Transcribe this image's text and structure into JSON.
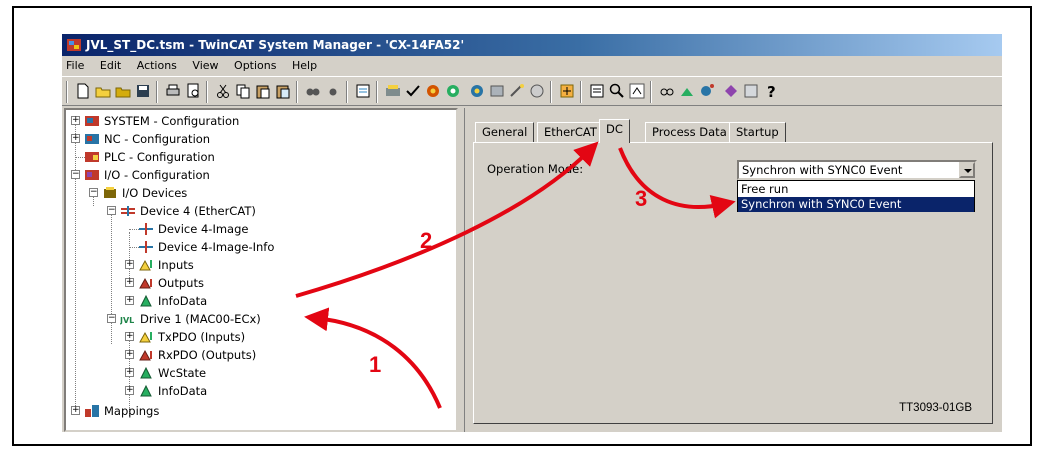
{
  "window": {
    "title": "JVL_ST_DC.tsm - TwinCAT System Manager - 'CX-14FA52'"
  },
  "menu": [
    "File",
    "Edit",
    "Actions",
    "View",
    "Options",
    "Help"
  ],
  "tree": {
    "nodes": [
      {
        "label": "SYSTEM - Configuration",
        "icon": "system-config-icon"
      },
      {
        "label": "NC - Configuration",
        "icon": "nc-config-icon"
      },
      {
        "label": "PLC - Configuration",
        "icon": "plc-config-icon"
      },
      {
        "label": "I/O - Configuration",
        "icon": "io-config-icon"
      },
      {
        "label": "I/O Devices",
        "icon": "io-devices-icon"
      },
      {
        "label": "Device 4 (EtherCAT)",
        "icon": "ethercat-device-icon"
      },
      {
        "label": "Device 4-Image",
        "icon": "image-icon"
      },
      {
        "label": "Device 4-Image-Info",
        "icon": "image-info-icon"
      },
      {
        "label": "Inputs",
        "icon": "inputs-icon"
      },
      {
        "label": "Outputs",
        "icon": "outputs-icon"
      },
      {
        "label": "InfoData",
        "icon": "infodata-icon"
      },
      {
        "label": "Drive 1 (MAC00-ECx)",
        "icon": "jvl-drive-icon"
      },
      {
        "label": "TxPDO (Inputs)",
        "icon": "inputs-icon"
      },
      {
        "label": "RxPDO (Outputs)",
        "icon": "outputs-icon"
      },
      {
        "label": "WcState",
        "icon": "wcstate-icon"
      },
      {
        "label": "InfoData",
        "icon": "infodata-icon"
      },
      {
        "label": "Mappings",
        "icon": "mappings-icon"
      }
    ]
  },
  "tabs": [
    "General",
    "EtherCAT",
    "DC",
    "Process Data",
    "Startup"
  ],
  "active_tab": "DC",
  "dc": {
    "operation_mode_label": "Operation Mode:",
    "operation_mode_value": "Synchron with SYNC0 Event",
    "options": [
      "Free run",
      "Synchron with SYNC0 Event"
    ]
  },
  "annotations": {
    "step1": "1",
    "step2": "2",
    "step3": "3",
    "figure_code": "TT3093-01GB",
    "arrow_color": "#e30613"
  }
}
